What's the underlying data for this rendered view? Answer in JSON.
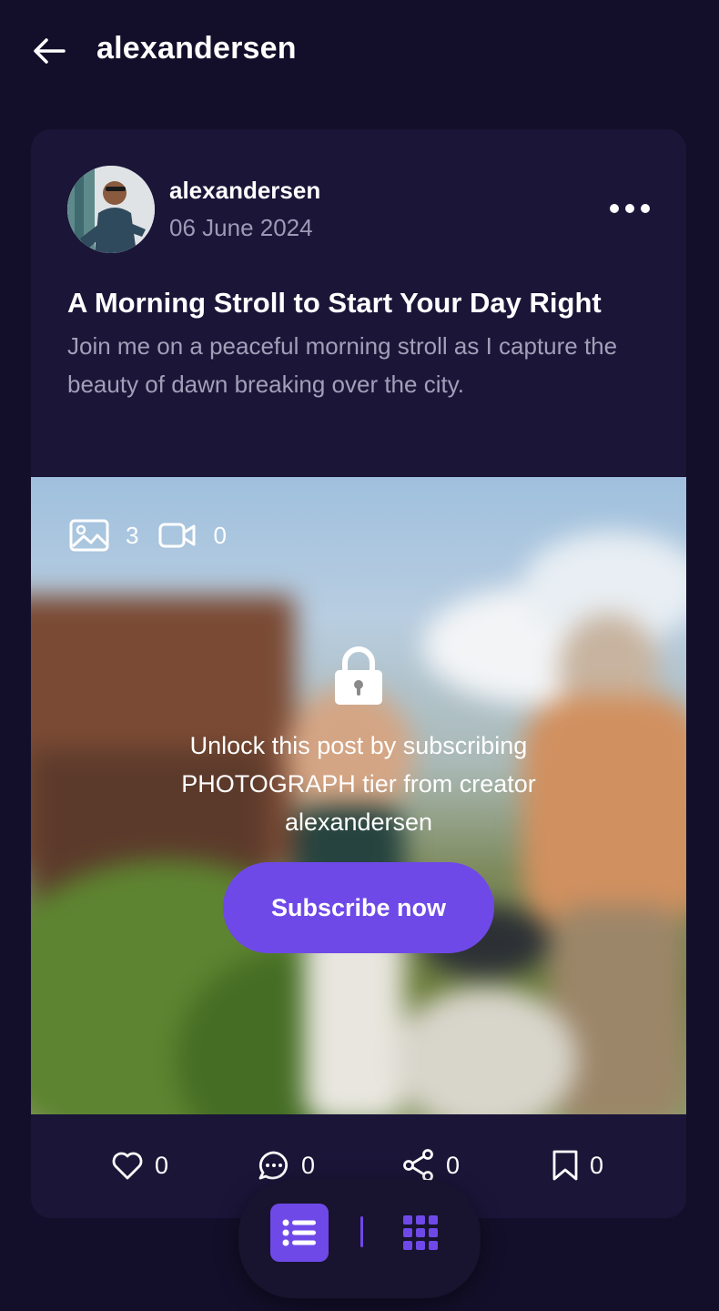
{
  "header": {
    "title": "alexandersen",
    "back_icon": "arrow-left-icon"
  },
  "post": {
    "author": "alexandersen",
    "date": "06 June 2024",
    "title": "A Morning Stroll to Start Your Day Right",
    "description": "Join me on a peaceful morning stroll as I capture the beauty of dawn breaking over the city.",
    "media": {
      "image_count": "3",
      "video_count": "0",
      "locked_message": "Unlock this post by subscribing PHOTOGRAPH tier from creator alexandersen",
      "subscribe_label": "Subscribe now"
    },
    "actions": {
      "likes": "0",
      "comments": "0",
      "shares": "0",
      "saves": "0"
    }
  },
  "view_toggle": {
    "active": "list",
    "list_icon": "list-icon",
    "grid_icon": "grid-icon"
  },
  "colors": {
    "background": "#130f2a",
    "card": "#1b1538",
    "accent": "#6f49e8",
    "muted_text": "#a39fb8"
  }
}
